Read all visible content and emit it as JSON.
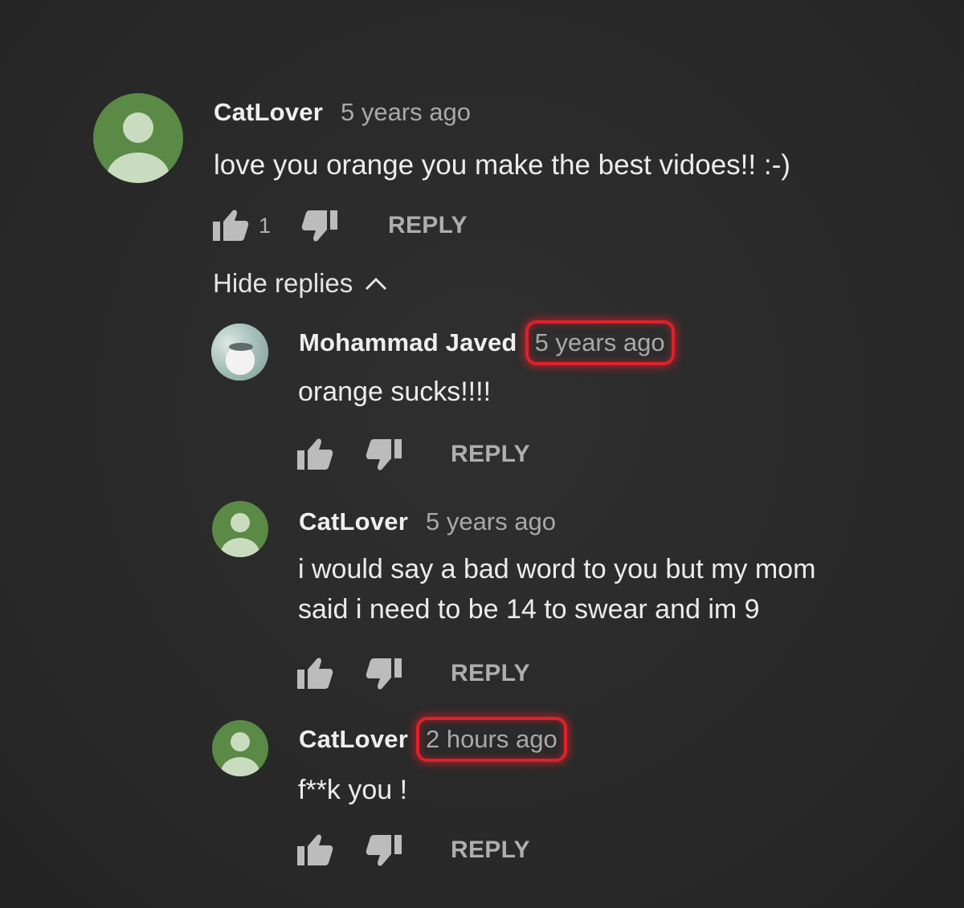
{
  "thread": {
    "top_comment": {
      "author": "CatLover",
      "time": "5 years ago",
      "text": "love you orange you make the best vidoes!! :-)",
      "like_count": "1",
      "reply_label": "REPLY",
      "avatar_icon": "default-avatar-icon"
    },
    "hide_replies_label": "Hide replies",
    "replies": [
      {
        "author": "Mohammad Javed",
        "time": "5 years ago",
        "time_highlighted": true,
        "text": "orange sucks!!!!",
        "reply_label": "REPLY",
        "avatar_icon": "profile-photo-avatar"
      },
      {
        "author": "CatLover",
        "time": "5 years ago",
        "time_highlighted": false,
        "text_line1": "i would say a bad word to you but my mom",
        "text_line2": "said i need to be 14 to swear and im 9",
        "reply_label": "REPLY",
        "avatar_icon": "default-avatar-icon"
      },
      {
        "author": "CatLover",
        "time": "2 hours ago",
        "time_highlighted": true,
        "text": "f**k you !",
        "reply_label": "REPLY",
        "avatar_icon": "default-avatar-icon"
      }
    ]
  },
  "colors": {
    "background": "#2a2a2a",
    "avatar_green": "#5a8a45",
    "highlight_red": "#e0202a",
    "secondary_text": "#a9a9a9"
  }
}
